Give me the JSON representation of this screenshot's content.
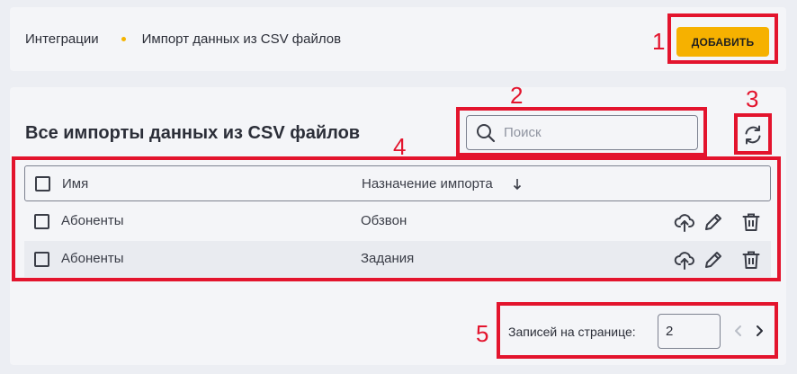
{
  "breadcrumb": {
    "items": [
      "Интеграции",
      "Импорт данных из CSV файлов"
    ]
  },
  "header": {
    "add_label": "ДОБАВИТЬ"
  },
  "main": {
    "title": "Все импорты данных из CSV файлов",
    "search_placeholder": "Поиск"
  },
  "table": {
    "columns": [
      "Имя",
      "Назначение импорта"
    ],
    "sort_indicator": "↓",
    "rows": [
      {
        "name": "Абоненты",
        "purpose": "Обзвон"
      },
      {
        "name": "Абоненты",
        "purpose": "Задания"
      }
    ]
  },
  "pagination": {
    "label": "Записей на странице:",
    "per_page": "2"
  },
  "annotations": [
    "1",
    "2",
    "3",
    "4",
    "5"
  ],
  "colors": {
    "accent": "#f6b100",
    "highlight": "#e3142d",
    "background": "#eceef3",
    "panel": "#f4f5f8"
  },
  "icons": [
    "search-icon",
    "refresh-icon",
    "upload-icon",
    "edit-icon",
    "delete-icon",
    "chevron-left-icon",
    "chevron-right-icon",
    "sort-arrow-icon"
  ]
}
